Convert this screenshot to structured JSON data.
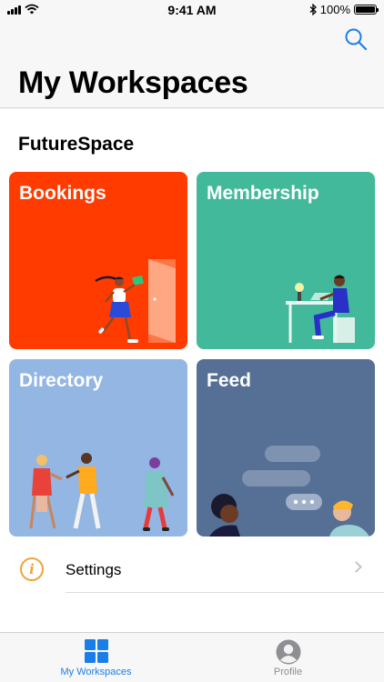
{
  "status_bar": {
    "time": "9:41 AM",
    "battery": "100%",
    "icons": [
      "signal-icon",
      "wifi-icon",
      "bluetooth-icon",
      "battery-icon"
    ]
  },
  "header": {
    "title": "My Workspaces",
    "search_icon": "search-icon"
  },
  "workspace": {
    "name": "FutureSpace",
    "tiles": [
      {
        "label": "Bookings",
        "color": "#ff3b00"
      },
      {
        "label": "Membership",
        "color": "#41b99a"
      },
      {
        "label": "Directory",
        "color": "#93b6e2"
      },
      {
        "label": "Feed",
        "color": "#556f95"
      }
    ]
  },
  "settings": {
    "label": "Settings",
    "icon": "info-icon"
  },
  "tab_bar": {
    "tabs": [
      {
        "label": "My Workspaces",
        "icon": "grid-icon",
        "active": true
      },
      {
        "label": "Profile",
        "icon": "profile-icon",
        "active": false
      }
    ],
    "active_color": "#1a7ee8",
    "inactive_color": "#8e8e93"
  }
}
